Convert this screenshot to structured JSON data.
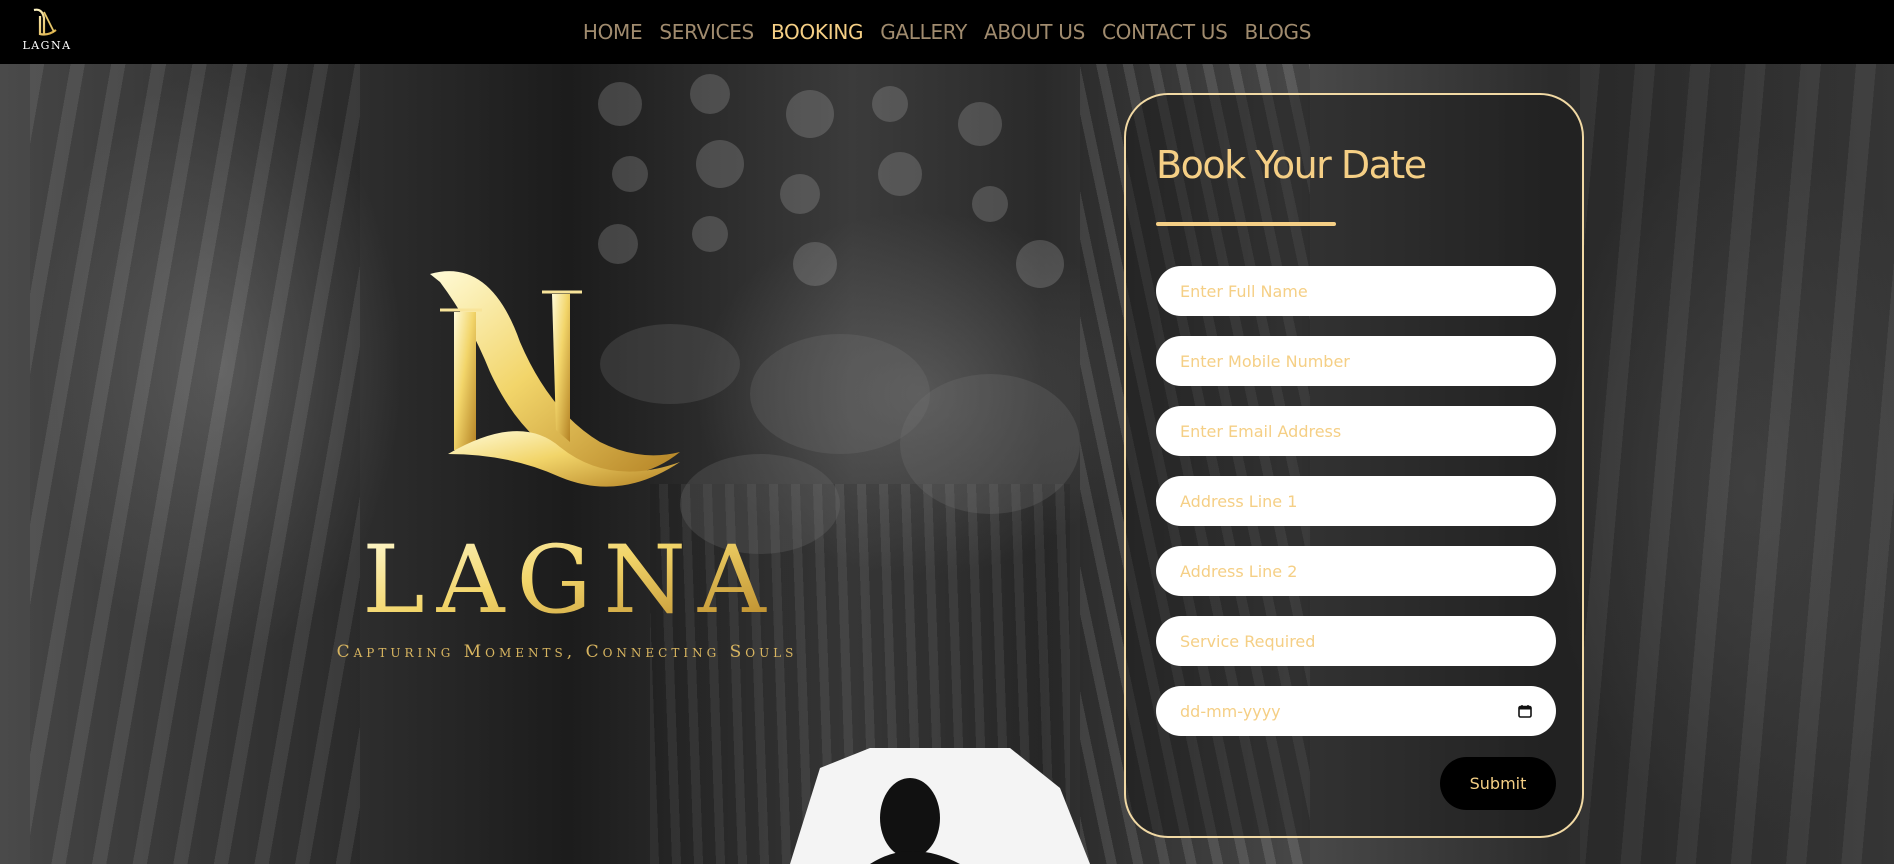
{
  "brand": {
    "name": "LAGNA",
    "monogram": "LN",
    "tagline": "Capturing Moments, Connecting Souls"
  },
  "nav": {
    "items": [
      {
        "label": "HOME"
      },
      {
        "label": "SERVICES"
      },
      {
        "label": "BOOKING",
        "active": true
      },
      {
        "label": "GALLERY"
      },
      {
        "label": "ABOUT US"
      },
      {
        "label": "CONTACT US"
      },
      {
        "label": "BLOGS"
      }
    ]
  },
  "booking": {
    "title": "Book Your Date",
    "fields": {
      "full_name": "Enter Full Name",
      "mobile": "Enter Mobile Number",
      "email": "Enter Email Address",
      "address1": "Address Line 1",
      "address2": "Address Line 2",
      "service": "Service Required",
      "date": "dd-mm-yyyy"
    },
    "submit_label": "Submit"
  },
  "colors": {
    "gold": "#f5cf85",
    "nav_inactive": "#a08b6e",
    "card_border": "#f1d9a4",
    "header_bg": "#000000"
  },
  "icons": {
    "date_picker": "calendar-icon"
  }
}
